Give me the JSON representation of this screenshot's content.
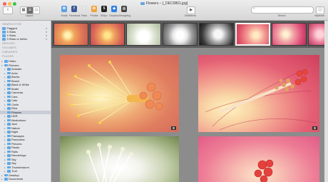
{
  "window": {
    "title": "Flowers – [_DEC0801.jpg]"
  },
  "toolbar": {
    "back": "‹",
    "layout_label": "Layout",
    "share": [
      {
        "label": "Email",
        "color": "#5aa1e3",
        "glyph": "✉"
      },
      {
        "label": "Facebook",
        "color": "#3b5998",
        "glyph": "f"
      },
      {
        "label": "Flickr",
        "color": "#e0e0e0",
        "glyph": "•"
      },
      {
        "label": "Photos",
        "color": "#f2a23c",
        "glyph": "✿"
      },
      {
        "label": "500px",
        "color": "#222222",
        "glyph": "5"
      },
      {
        "label": "Dropbox",
        "color": "#2d7ee0",
        "glyph": "◆"
      },
      {
        "label": "SmugMug",
        "color": "#444444",
        "glyph": "◎"
      }
    ],
    "slideshow_label": "Slideshow",
    "search_label": "Search",
    "search_placeholder": "",
    "inspector_label": "Inspector"
  },
  "sidebar": {
    "sections": {
      "search": "SEARCH FOR",
      "devices": "DEVICES",
      "volumes": "VOLUMES",
      "libraries": "LIBRARIES",
      "places": "PLACES"
    },
    "search_items": [
      "Flagged",
      "5 Stars",
      "4 Stars",
      "3 Stars or better"
    ],
    "places": [
      {
        "label": "Hotko",
        "level": 0,
        "tri": "▸"
      },
      {
        "label": "Pictures",
        "level": 0,
        "tri": "▾"
      },
      {
        "label": "Animals",
        "level": 1,
        "tri": "▸"
      },
      {
        "label": "Aves",
        "level": 1,
        "tri": "▸"
      },
      {
        "label": "Bacha",
        "level": 1,
        "tri": "▸"
      },
      {
        "label": "Beach",
        "level": 1,
        "tri": "▸"
      },
      {
        "label": "Black & White",
        "level": 1,
        "tri": "▸"
      },
      {
        "label": "Boats",
        "level": 1,
        "tri": "▸"
      },
      {
        "label": "Cameras",
        "level": 1,
        "tri": "▸"
      },
      {
        "label": "Cars",
        "level": 1,
        "tri": "▸"
      },
      {
        "label": "Cats",
        "level": 1,
        "tri": "▸"
      },
      {
        "label": "Circle",
        "level": 1,
        "tri": "▸"
      },
      {
        "label": "Elba",
        "level": 1,
        "tri": "▸"
      },
      {
        "label": "Flowers",
        "level": 1,
        "tri": "",
        "selected": true
      },
      {
        "label": "HDR",
        "level": 1,
        "tri": "▸"
      },
      {
        "label": "Illustrations",
        "level": 1,
        "tri": "▸"
      },
      {
        "label": "Jazz",
        "level": 1,
        "tri": "▸"
      },
      {
        "label": "Nature",
        "level": 1,
        "tri": "▸"
      },
      {
        "label": "Night",
        "level": 1,
        "tri": "▸"
      },
      {
        "label": "Paesages",
        "level": 1,
        "tri": "▸"
      },
      {
        "label": "Panorama",
        "level": 1,
        "tri": "▸"
      },
      {
        "label": "Pictures",
        "level": 1,
        "tri": "▸"
      },
      {
        "label": "Plants",
        "level": 1,
        "tri": "▸"
      },
      {
        "label": "Rails",
        "level": 1,
        "tri": "▸"
      },
      {
        "label": "Renderings",
        "level": 1,
        "tri": "▸"
      },
      {
        "label": "Sky",
        "level": 1,
        "tri": "▸"
      },
      {
        "label": "Sky",
        "level": 1,
        "tri": "▸"
      },
      {
        "label": "Thunderstorm",
        "level": 1,
        "tri": "▸"
      },
      {
        "label": "Trull",
        "level": 1,
        "tri": "▸"
      },
      {
        "label": "Desktop",
        "level": 0,
        "tri": "▸"
      },
      {
        "label": "Documents",
        "level": 0,
        "tri": "▸"
      }
    ]
  },
  "colors": {
    "accent_folder": "#5da7e8",
    "selection": "#c8cdd6"
  }
}
